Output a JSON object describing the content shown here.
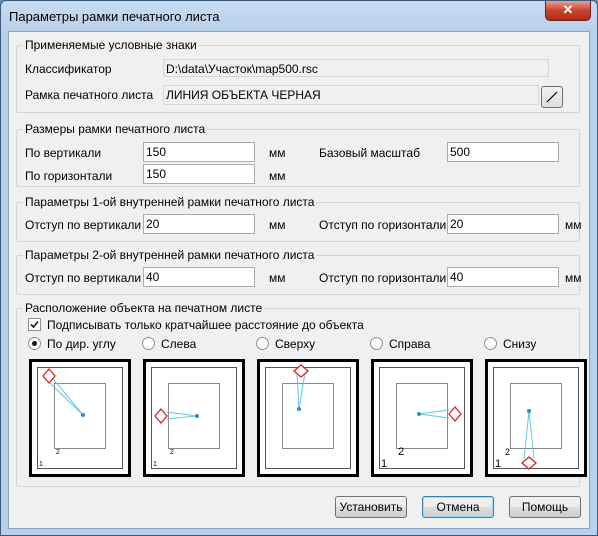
{
  "window": {
    "title": "Параметры рамки печатного листа",
    "close_glyph": "✕"
  },
  "symbols": {
    "legend": "Применяемые условные знаки",
    "classifier_label": "Классификатор",
    "classifier_value": "D:\\data\\Участок\\map500.rsc",
    "frame_label": "Рамка печатного листа",
    "frame_value": "ЛИНИЯ ОБЪЕКТА ЧЕРНАЯ"
  },
  "sizes": {
    "legend": "Размеры рамки печатного листа",
    "vertical_label": "По вертикали",
    "vertical_value": "150",
    "horizontal_label": "По горизонтали",
    "horizontal_value": "150",
    "unit": "мм",
    "scale_label": "Базовый масштаб",
    "scale_value": "500"
  },
  "inner1": {
    "legend": "Параметры 1-ой внутренней рамки печатного листа",
    "vertical_label": "Отступ по вертикали",
    "vertical_value": "20",
    "horizontal_label": "Отступ по горизонтали",
    "horizontal_value": "20",
    "unit": "мм"
  },
  "inner2": {
    "legend": "Параметры 2-ой внутренней рамки печатного листа",
    "vertical_label": "Отступ по вертикали",
    "vertical_value": "40",
    "horizontal_label": "Отступ по горизонтали",
    "horizontal_value": "40",
    "unit": "мм"
  },
  "placement": {
    "legend": "Расположение  объекта на печатном листе",
    "shortest_label": "Подписывать только кратчайшее расстояние до объекта",
    "shortest_checked": true,
    "options": [
      {
        "label": "По дир. углу",
        "selected": true
      },
      {
        "label": "Слева",
        "selected": false
      },
      {
        "label": "Сверху",
        "selected": false
      },
      {
        "label": "Справа",
        "selected": false
      },
      {
        "label": "Снизу",
        "selected": false
      }
    ],
    "frame_numbers": [
      "1",
      "2"
    ]
  },
  "buttons": {
    "apply": "Установить",
    "cancel": "Отмена",
    "help": "Помощь"
  }
}
